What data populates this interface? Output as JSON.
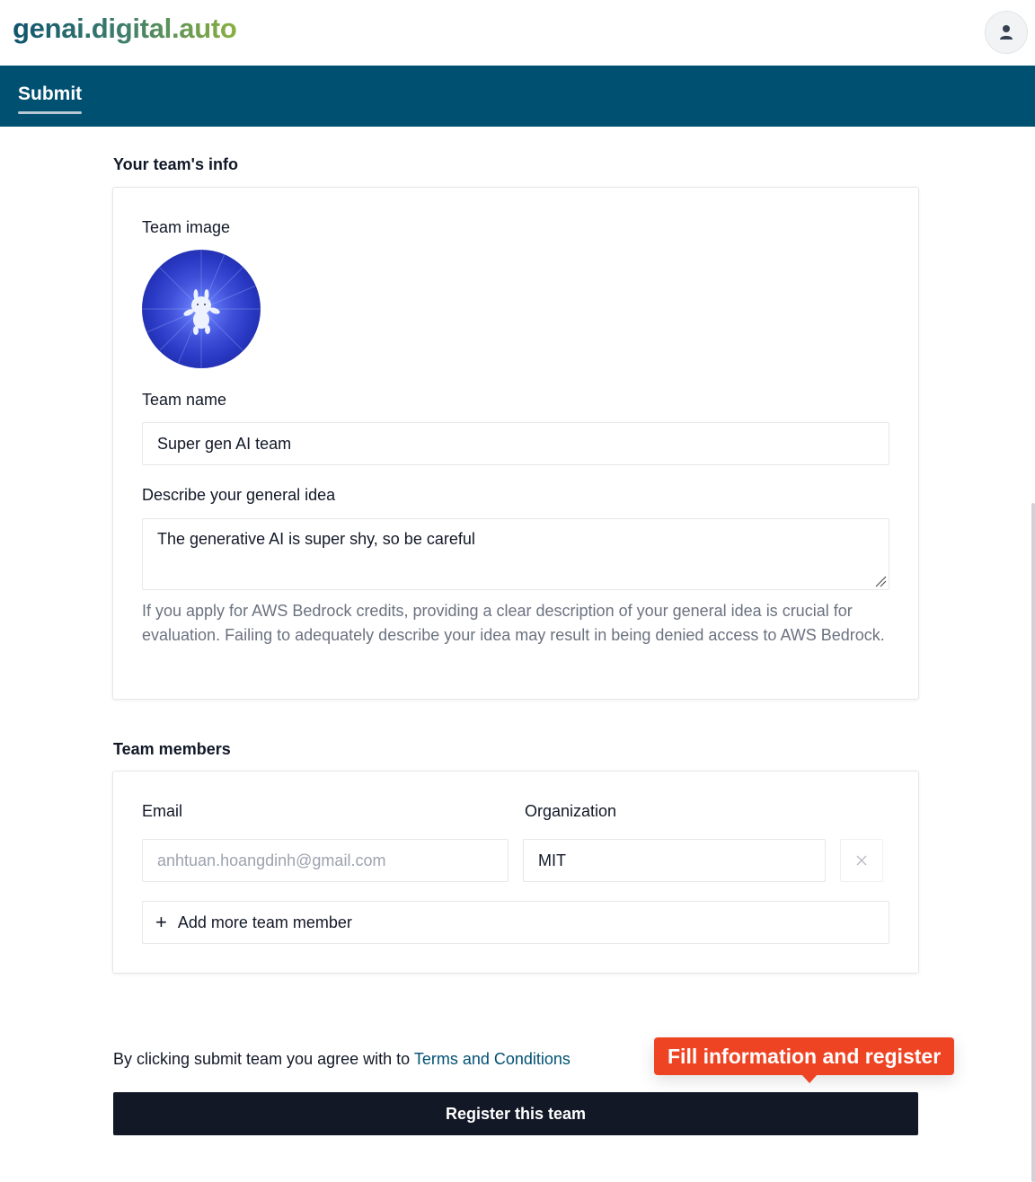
{
  "header": {
    "logo_text": "genai.digital.auto",
    "user_button_icon": "user-icon"
  },
  "tabs": [
    {
      "label": "Submit",
      "active": true
    }
  ],
  "team_info": {
    "section_title": "Your team's info",
    "team_image_label": "Team image",
    "team_name_label": "Team name",
    "team_name_value": "Super gen AI team",
    "idea_label": "Describe your general idea",
    "idea_value": "The generative AI is super shy, so be careful",
    "helper_text": "If you apply for AWS Bedrock credits, providing a clear description of your general idea is crucial for evaluation. Failing to adequately describe your idea may result in being denied access to AWS Bedrock."
  },
  "team_members": {
    "section_title": "Team members",
    "email_header": "Email",
    "organization_header": "Organization",
    "members": [
      {
        "email": "anhtuan.hoangdinh@gmail.com",
        "organization": "MIT"
      }
    ],
    "add_member_label": "Add more team member",
    "remove_icon": "close-icon"
  },
  "footer": {
    "terms_prefix": "By clicking submit team you agree with to",
    "terms_link": "Terms and Conditions",
    "tooltip_text": "Fill information and register",
    "register_button": "Register this team"
  },
  "colors": {
    "nav_bg": "#005072",
    "tooltip_bg": "#ef4423",
    "button_bg": "#121826",
    "link": "#005072"
  }
}
